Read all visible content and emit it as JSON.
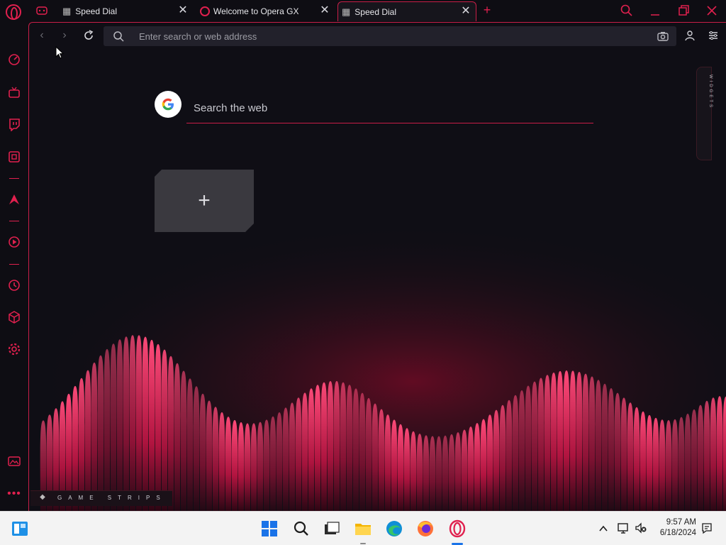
{
  "tabs": [
    {
      "label": "Speed Dial",
      "active": false
    },
    {
      "label": "Welcome to Opera GX",
      "active": false
    },
    {
      "label": "Speed Dial",
      "active": true
    }
  ],
  "window_controls": {
    "search_icon": "search-icon",
    "minimize": "minimize-icon",
    "restore": "restore-icon",
    "close": "close-icon"
  },
  "sidebar": {
    "items": [
      "speed-icon",
      "gx-corner-icon",
      "twitch-icon",
      "gx-control-icon",
      "aria-icon",
      "player-icon",
      "history-icon",
      "extensions-icon",
      "settings-icon",
      "wallpaper-icon",
      "more-icon"
    ]
  },
  "toolbar": {
    "address_placeholder": "Enter search or web address"
  },
  "speed_dial": {
    "search_placeholder": "Search the web",
    "widgets_label": "WIDGETS",
    "game_strips_label": "GAME STRIPS"
  },
  "taskbar": {
    "time": "9:57 AM",
    "date": "6/18/2024"
  },
  "colors": {
    "accent": "#e0204e",
    "background": "#0f0e15",
    "taskbar": "#f3f3f3"
  }
}
